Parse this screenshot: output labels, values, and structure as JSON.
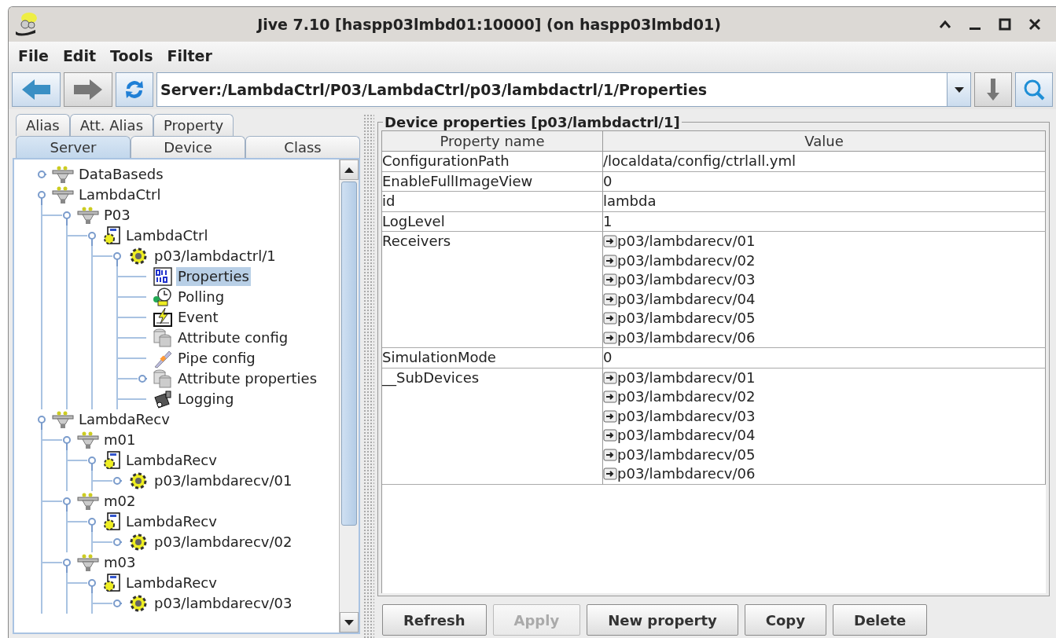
{
  "window": {
    "title": "Jive 7.10 [haspp03lmbd01:10000] (on haspp03lmbd01)"
  },
  "menu": [
    "File",
    "Edit",
    "Tools",
    "Filter"
  ],
  "toolbar": {
    "address": "Server:/LambdaCtrl/P03/LambdaCtrl/p03/lambdactrl/1/Properties"
  },
  "tabs_top": [
    {
      "label": "Alias",
      "selected": false
    },
    {
      "label": "Att. Alias",
      "selected": false
    },
    {
      "label": "Property",
      "selected": false
    }
  ],
  "tabs_bottom": [
    {
      "label": "Server",
      "selected": true
    },
    {
      "label": "Device",
      "selected": false
    },
    {
      "label": "Class",
      "selected": false
    }
  ],
  "tree": [
    {
      "label": "DataBaseds",
      "kind": "server",
      "expanded": false,
      "selected": false
    },
    {
      "label": "LambdaCtrl",
      "kind": "server",
      "expanded": true,
      "selected": false,
      "children": [
        {
          "label": "P03",
          "kind": "server",
          "expanded": true,
          "selected": false,
          "children": [
            {
              "label": "LambdaCtrl",
              "kind": "class",
              "expanded": true,
              "selected": false,
              "children": [
                {
                  "label": "p03/lambdactrl/1",
                  "kind": "device",
                  "expanded": true,
                  "selected": false,
                  "children": [
                    {
                      "label": "Properties",
                      "kind": "properties",
                      "selected": true
                    },
                    {
                      "label": "Polling",
                      "kind": "polling",
                      "selected": false
                    },
                    {
                      "label": "Event",
                      "kind": "event",
                      "selected": false
                    },
                    {
                      "label": "Attribute config",
                      "kind": "attributes",
                      "selected": false
                    },
                    {
                      "label": "Pipe config",
                      "kind": "pipe",
                      "selected": false
                    },
                    {
                      "label": "Attribute properties",
                      "kind": "attributes",
                      "expanded": false,
                      "selected": false
                    },
                    {
                      "label": "Logging",
                      "kind": "logging",
                      "selected": false
                    }
                  ]
                }
              ]
            }
          ]
        }
      ]
    },
    {
      "label": "LambdaRecv",
      "kind": "server",
      "expanded": true,
      "selected": false,
      "children": [
        {
          "label": "m01",
          "kind": "server",
          "expanded": true,
          "selected": false,
          "children": [
            {
              "label": "LambdaRecv",
              "kind": "class",
              "expanded": true,
              "selected": false,
              "children": [
                {
                  "label": "p03/lambdarecv/01",
                  "kind": "device",
                  "expanded": false,
                  "selected": false
                }
              ]
            }
          ]
        },
        {
          "label": "m02",
          "kind": "server",
          "expanded": true,
          "selected": false,
          "children": [
            {
              "label": "LambdaRecv",
              "kind": "class",
              "expanded": true,
              "selected": false,
              "children": [
                {
                  "label": "p03/lambdarecv/02",
                  "kind": "device",
                  "expanded": false,
                  "selected": false
                }
              ]
            }
          ]
        },
        {
          "label": "m03",
          "kind": "server",
          "expanded": true,
          "selected": false,
          "children": [
            {
              "label": "LambdaRecv",
              "kind": "class",
              "expanded": true,
              "selected": false,
              "children": [
                {
                  "label": "p03/lambdarecv/03",
                  "kind": "device",
                  "expanded": false,
                  "selected": false
                }
              ]
            }
          ]
        }
      ]
    }
  ],
  "properties": {
    "title": "Device properties [p03/lambdactrl/1]",
    "columns": [
      "Property name",
      "Value"
    ],
    "rows": [
      {
        "name": "ConfigurationPath",
        "kind": "text",
        "values": [
          "/localdata/config/ctrlall.yml"
        ]
      },
      {
        "name": "EnableFullImageView",
        "kind": "text",
        "values": [
          "0"
        ]
      },
      {
        "name": "id",
        "kind": "text",
        "values": [
          "lambda"
        ]
      },
      {
        "name": "LogLevel",
        "kind": "text",
        "values": [
          "1"
        ]
      },
      {
        "name": "Receivers",
        "kind": "list",
        "values": [
          "p03/lambdarecv/01",
          "p03/lambdarecv/02",
          "p03/lambdarecv/03",
          "p03/lambdarecv/04",
          "p03/lambdarecv/05",
          "p03/lambdarecv/06"
        ]
      },
      {
        "name": "SimulationMode",
        "kind": "text",
        "values": [
          "0"
        ]
      },
      {
        "name": "__SubDevices",
        "kind": "list",
        "values": [
          "p03/lambdarecv/01",
          "p03/lambdarecv/02",
          "p03/lambdarecv/03",
          "p03/lambdarecv/04",
          "p03/lambdarecv/05",
          "p03/lambdarecv/06"
        ]
      }
    ]
  },
  "buttons": [
    {
      "label": "Refresh",
      "disabled": false
    },
    {
      "label": "Apply",
      "disabled": true
    },
    {
      "label": "New property",
      "disabled": false
    },
    {
      "label": "Copy",
      "disabled": false
    },
    {
      "label": "Delete",
      "disabled": false
    }
  ]
}
